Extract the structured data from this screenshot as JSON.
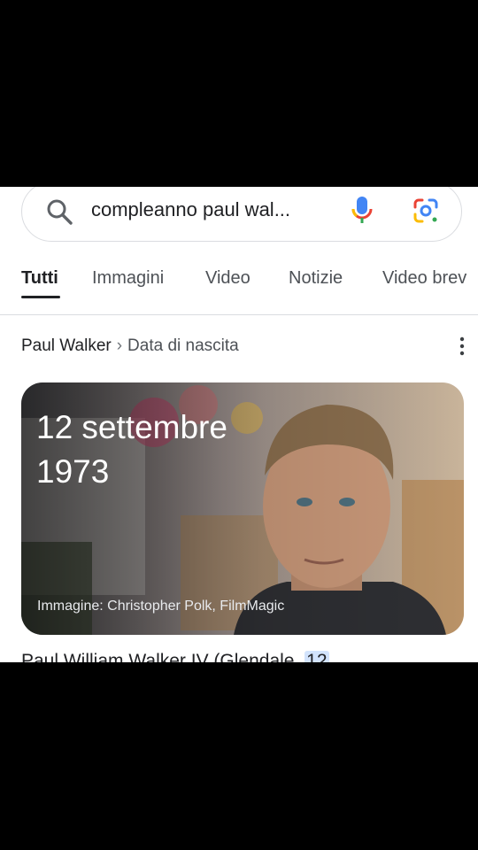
{
  "search": {
    "query": "compleanno paul wal...",
    "icons": {
      "search": "search-icon",
      "voice": "mic-icon",
      "camera": "google-lens-icon"
    }
  },
  "tabs": [
    {
      "label": "Tutti",
      "active": true
    },
    {
      "label": "Immagini"
    },
    {
      "label": "Video"
    },
    {
      "label": "Notizie"
    },
    {
      "label": "Video brev"
    }
  ],
  "result": {
    "entity": "Paul Walker",
    "separator": "›",
    "attribute": "Data di nascita",
    "answer_line1": "12 settembre",
    "answer_line2": "1973",
    "image_credit": "Immagine: Christopher Polk, FilmMagic",
    "snippet_text": "Paul William Walker IV (Glendale, ",
    "snippet_highlight": "12"
  },
  "colors": {
    "text": "#202124",
    "muted": "#4d5156",
    "divider": "#dadce0",
    "highlight": "#d2e3fc"
  }
}
